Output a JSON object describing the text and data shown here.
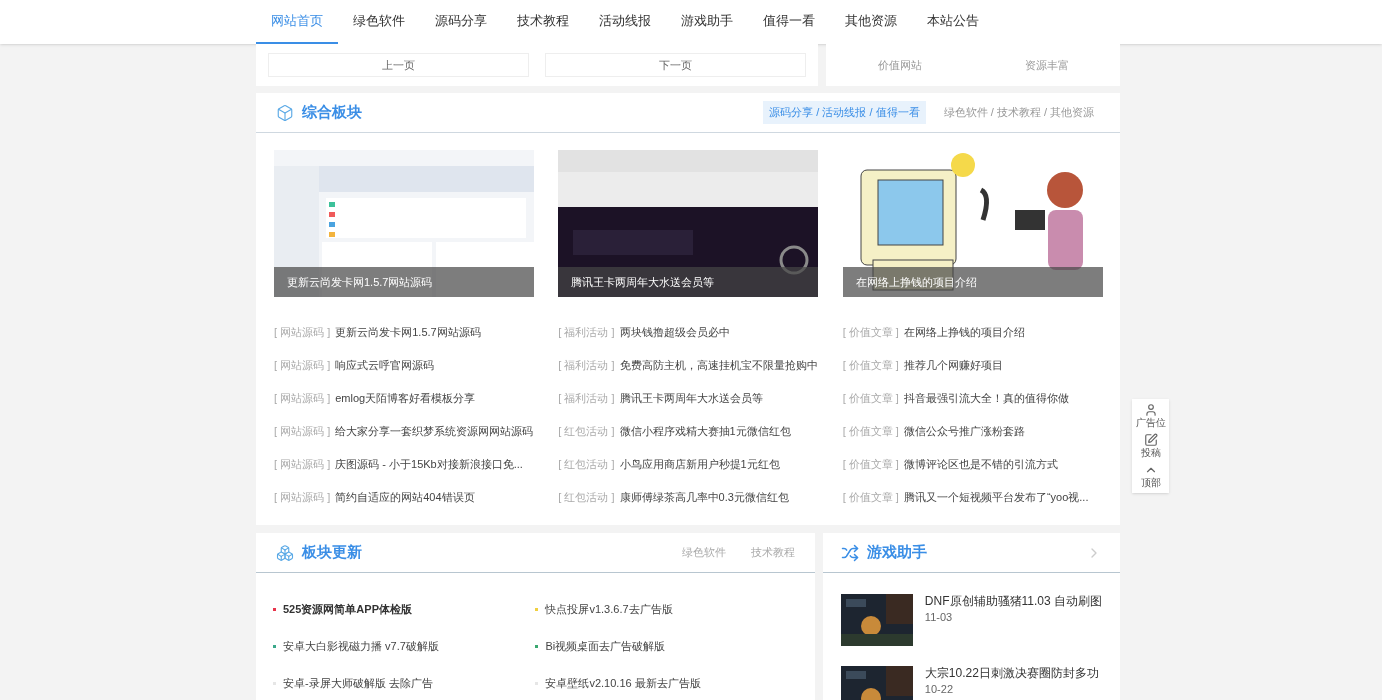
{
  "nav": [
    {
      "label": "网站首页",
      "selected": true
    },
    {
      "label": "绿色软件",
      "selected": false
    },
    {
      "label": "源码分享",
      "selected": false
    },
    {
      "label": "技术教程",
      "selected": false
    },
    {
      "label": "活动线报",
      "selected": false
    },
    {
      "label": "游戏助手",
      "selected": false
    },
    {
      "label": "值得一看",
      "selected": false
    },
    {
      "label": "其他资源",
      "selected": false
    },
    {
      "label": "本站公告",
      "selected": false
    }
  ],
  "pager": {
    "prev": "上一页",
    "next": "下一页"
  },
  "links": [
    "价值网站",
    "资源丰富"
  ],
  "section": {
    "title": "综合板块",
    "tabs": [
      {
        "label": "源码分享 / 活动线报 / 值得一看",
        "selected": true
      },
      {
        "label": "绿色软件 / 技术教程 / 其他资源",
        "selected": false
      }
    ],
    "columns": [
      {
        "caption": "更新云尚发卡网1.5.7网站源码",
        "items": [
          {
            "tag": "[ 网站源码 ]",
            "title": "更新云尚发卡网1.5.7网站源码"
          },
          {
            "tag": "[ 网站源码 ]",
            "title": "响应式云呼官网源码"
          },
          {
            "tag": "[ 网站源码 ]",
            "title": "emlog天陌博客好看模板分享"
          },
          {
            "tag": "[ 网站源码 ]",
            "title": "给大家分享一套织梦系统资源网网站源码"
          },
          {
            "tag": "[ 网站源码 ]",
            "title": "庆图源码 - 小于15Kb对接新浪接口免..."
          },
          {
            "tag": "[ 网站源码 ]",
            "title": "简约自适应的网站404错误页"
          }
        ]
      },
      {
        "caption": "腾讯王卡两周年大水送会员等",
        "items": [
          {
            "tag": "[ 福利活动 ]",
            "title": "两块钱撸超级会员必中"
          },
          {
            "tag": "[ 福利活动 ]",
            "title": "免费高防主机，高速挂机宝不限量抢购中"
          },
          {
            "tag": "[ 福利活动 ]",
            "title": "腾讯王卡两周年大水送会员等"
          },
          {
            "tag": "[ 红包活动 ]",
            "title": "微信小程序戏精大赛抽1元微信红包"
          },
          {
            "tag": "[ 红包活动 ]",
            "title": "小鸟应用商店新用户秒提1元红包"
          },
          {
            "tag": "[ 红包活动 ]",
            "title": "康师傅绿茶高几率中0.3元微信红包"
          }
        ]
      },
      {
        "caption": "在网络上挣钱的项目介绍",
        "items": [
          {
            "tag": "[ 价值文章 ]",
            "title": "在网络上挣钱的项目介绍"
          },
          {
            "tag": "[ 价值文章 ]",
            "title": "推荐几个网赚好项目"
          },
          {
            "tag": "[ 价值文章 ]",
            "title": "抖音最强引流大全！真的值得你做"
          },
          {
            "tag": "[ 价值文章 ]",
            "title": "微信公众号推广涨粉套路"
          },
          {
            "tag": "[ 价值文章 ]",
            "title": "微博评论区也是不错的引流方式"
          },
          {
            "tag": "[ 价值文章 ]",
            "title": "腾讯又一个短视频平台发布了“yoo视..."
          }
        ]
      }
    ]
  },
  "updates": {
    "title": "板块更新",
    "tabs": [
      "绿色软件",
      "技术教程"
    ],
    "items": [
      {
        "title": "525资源网简单APP体检版",
        "color": "#e8334a",
        "bold": true
      },
      {
        "title": "快点投屏v1.3.6.7去广告版",
        "color": "#f0d040",
        "bold": false
      },
      {
        "title": "安卓大白影视磁力播 v7.7破解版",
        "color": "#3aa88a",
        "bold": false
      },
      {
        "title": "Bi视频桌面去广告破解版",
        "color": "#3aa870",
        "bold": false
      },
      {
        "title": "安卓-录屏大师破解版 去除广告",
        "color": "#e6e6e6",
        "bold": false
      },
      {
        "title": "安卓壁纸v2.10.16 最新去广告版",
        "color": "#e6e6e6",
        "bold": false
      }
    ]
  },
  "games": {
    "title": "游戏助手",
    "items": [
      {
        "title": "DNF原创辅助骚猪11.03 自动刷图",
        "date": "11-03"
      },
      {
        "title": "大宗10.22日刺激决赛圈防封多功",
        "date": "10-22"
      }
    ]
  },
  "float_bar": [
    "广告位",
    "投稿",
    "顶部"
  ]
}
